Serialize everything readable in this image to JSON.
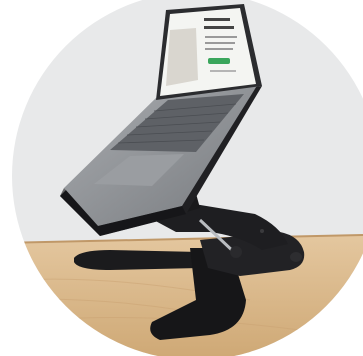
{
  "photo": {
    "subject": "laptop-stand-with-laptop",
    "colors": {
      "circle_bg": "#e8e9ea",
      "desk": "#d9b98f",
      "stand": "#1b1b1d",
      "laptop_body": "#8b8e92",
      "keyboard": "#5e6166",
      "screen_bg": "#f4f5f2",
      "screen_accent": "#3aa65c"
    }
  }
}
